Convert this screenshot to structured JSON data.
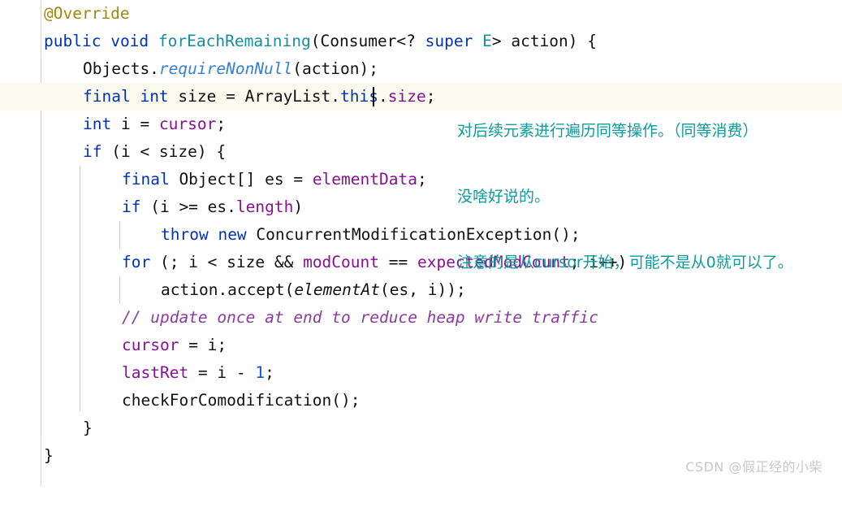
{
  "editor": {
    "background": "#ffffff",
    "current_line_highlight": "#fbfaee",
    "caret_line_index": 3,
    "colors": {
      "keyword": "#0033b3",
      "annotation": "#9e880d",
      "type": "#1a8d9c",
      "field": "#871094",
      "static_method": "#3681d8",
      "number": "#1750eb",
      "comment": "#8c3ba0",
      "plain": "#111111",
      "note": "#0d9c9c",
      "watermark": "#c9c9c9"
    },
    "lines": [
      {
        "n": 1,
        "indent": 0,
        "text": "@Override"
      },
      {
        "n": 2,
        "indent": 0,
        "text": "public void forEachRemaining(Consumer<? super E> action) {"
      },
      {
        "n": 3,
        "indent": 1,
        "text": "Objects.requireNonNull(action);"
      },
      {
        "n": 4,
        "indent": 1,
        "text": "final int size = ArrayList.this.size;"
      },
      {
        "n": 5,
        "indent": 1,
        "text": "int i = cursor;"
      },
      {
        "n": 6,
        "indent": 1,
        "text": "if (i < size) {"
      },
      {
        "n": 7,
        "indent": 2,
        "text": "final Object[] es = elementData;"
      },
      {
        "n": 8,
        "indent": 2,
        "text": "if (i >= es.length)"
      },
      {
        "n": 9,
        "indent": 3,
        "text": "throw new ConcurrentModificationException();"
      },
      {
        "n": 10,
        "indent": 2,
        "text": "for (; i < size && modCount == expectedModCount; i++)"
      },
      {
        "n": 11,
        "indent": 3,
        "text": "action.accept(elementAt(es, i));"
      },
      {
        "n": 12,
        "indent": 2,
        "text": "// update once at end to reduce heap write traffic"
      },
      {
        "n": 13,
        "indent": 2,
        "text": "cursor = i;"
      },
      {
        "n": 14,
        "indent": 2,
        "text": "lastRet = i - 1;"
      },
      {
        "n": 15,
        "indent": 2,
        "text": "checkForComodification();"
      },
      {
        "n": 16,
        "indent": 1,
        "text": "}"
      },
      {
        "n": 17,
        "indent": 0,
        "text": "}"
      }
    ]
  },
  "annotations": {
    "line1": "对后续元素进行遍历同等操作。（同等消费）",
    "line2": "没啥好说的。",
    "line3": "注意的是从cursor开始，可能不是从0就可以了。"
  },
  "watermark": {
    "text": "CSDN @假正经的小柴"
  }
}
